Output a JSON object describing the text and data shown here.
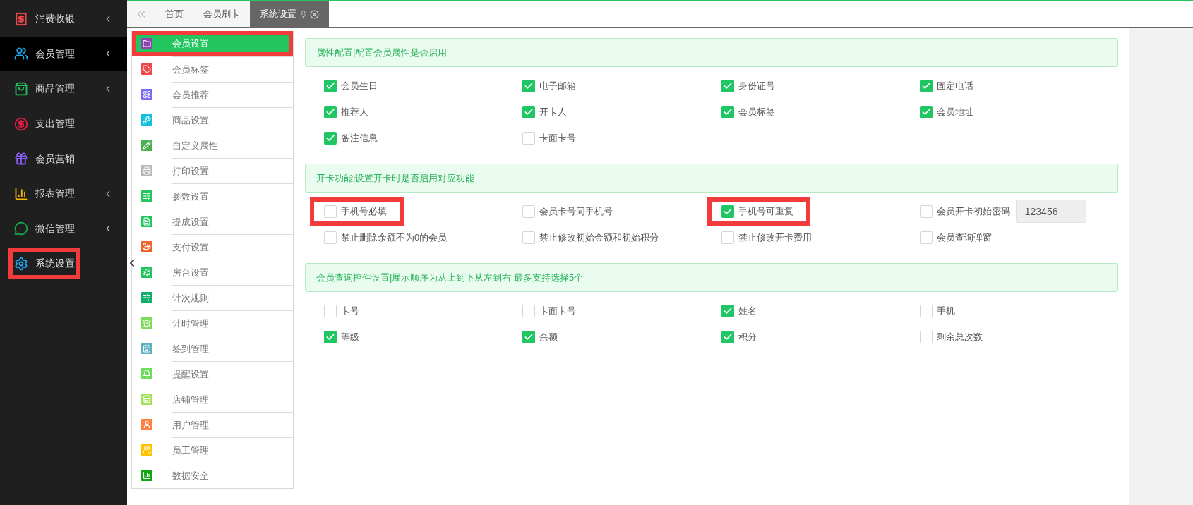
{
  "sidebar": {
    "items": [
      {
        "label": "消费收银",
        "color": "#e5484d",
        "has_submenu": true,
        "selected": false,
        "highlighted": false
      },
      {
        "label": "会员管理",
        "color": "#1ea7f0",
        "has_submenu": true,
        "selected": true,
        "highlighted": false
      },
      {
        "label": "商品管理",
        "color": "#22c55e",
        "has_submenu": true,
        "selected": false,
        "highlighted": false
      },
      {
        "label": "支出管理",
        "color": "#e11d48",
        "has_submenu": false,
        "selected": false,
        "highlighted": false
      },
      {
        "label": "会员营销",
        "color": "#8b5cf6",
        "has_submenu": false,
        "selected": false,
        "highlighted": false
      },
      {
        "label": "报表管理",
        "color": "#f5b50a",
        "has_submenu": true,
        "selected": false,
        "highlighted": false
      },
      {
        "label": "微信管理",
        "color": "#16a34a",
        "has_submenu": true,
        "selected": false,
        "highlighted": false
      },
      {
        "label": "系统设置",
        "color": "#1ea7f0",
        "has_submenu": false,
        "selected": false,
        "highlighted": true
      }
    ]
  },
  "tabs": [
    {
      "label": "首页",
      "selected": false,
      "pinned": false
    },
    {
      "label": "会员刷卡",
      "selected": false,
      "pinned": false
    },
    {
      "label": "系统设置",
      "selected": true,
      "pinned": true
    }
  ],
  "settings_menu": [
    {
      "label": "会员设置",
      "color": "#8e44ad",
      "selected": true,
      "highlighted": true
    },
    {
      "label": "会员标签",
      "color": "#f04848",
      "selected": false,
      "highlighted": false
    },
    {
      "label": "会员推荐",
      "color": "#7b6cf6",
      "selected": false,
      "highlighted": false
    },
    {
      "label": "商品设置",
      "color": "#14c0e0",
      "selected": false,
      "highlighted": false
    },
    {
      "label": "自定义属性",
      "color": "#4caf50",
      "selected": false,
      "highlighted": false
    },
    {
      "label": "打印设置",
      "color": "#b8b8b8",
      "selected": false,
      "highlighted": false
    },
    {
      "label": "参数设置",
      "color": "#22c55e",
      "selected": false,
      "highlighted": false
    },
    {
      "label": "提成设置",
      "color": "#22c55e",
      "selected": false,
      "highlighted": false
    },
    {
      "label": "支付设置",
      "color": "#f4622b",
      "selected": false,
      "highlighted": false
    },
    {
      "label": "房台设置",
      "color": "#22c55e",
      "selected": false,
      "highlighted": false
    },
    {
      "label": "计次规则",
      "color": "#0fae6a",
      "selected": false,
      "highlighted": false
    },
    {
      "label": "计时管理",
      "color": "#7ed957",
      "selected": false,
      "highlighted": false
    },
    {
      "label": "签到管理",
      "color": "#5bb0c0",
      "selected": false,
      "highlighted": false
    },
    {
      "label": "提醒设置",
      "color": "#6ddc5a",
      "selected": false,
      "highlighted": false
    },
    {
      "label": "店铺管理",
      "color": "#a3e05a",
      "selected": false,
      "highlighted": false
    },
    {
      "label": "用户管理",
      "color": "#ff8040",
      "selected": false,
      "highlighted": false
    },
    {
      "label": "员工管理",
      "color": "#ffc400",
      "selected": false,
      "highlighted": false
    },
    {
      "label": "数据安全",
      "color": "#11a611",
      "selected": false,
      "highlighted": false
    }
  ],
  "sections": [
    {
      "title": "属性配置|配置会员属性是否启用",
      "options": [
        {
          "label": "会员生日",
          "checked": true,
          "highlighted": false
        },
        {
          "label": "电子邮箱",
          "checked": true,
          "highlighted": false
        },
        {
          "label": "身份证号",
          "checked": true,
          "highlighted": false
        },
        {
          "label": "固定电话",
          "checked": true,
          "highlighted": false
        },
        {
          "label": "推荐人",
          "checked": true,
          "highlighted": false
        },
        {
          "label": "开卡人",
          "checked": true,
          "highlighted": false
        },
        {
          "label": "会员标签",
          "checked": true,
          "highlighted": false
        },
        {
          "label": "会员地址",
          "checked": true,
          "highlighted": false
        },
        {
          "label": "备注信息",
          "checked": true,
          "highlighted": false
        },
        {
          "label": "卡面卡号",
          "checked": false,
          "highlighted": false
        }
      ]
    },
    {
      "title": "开卡功能|设置开卡时是否启用对应功能",
      "options": [
        {
          "label": "手机号必填",
          "checked": false,
          "highlighted": true
        },
        {
          "label": "会员卡号同手机号",
          "checked": false,
          "highlighted": false
        },
        {
          "label": "手机号可重复",
          "checked": true,
          "highlighted": true
        },
        {
          "label": "会员开卡初始密码",
          "checked": false,
          "highlighted": false,
          "value": "123456"
        },
        {
          "label": "禁止删除余额不为0的会员",
          "checked": false,
          "highlighted": false
        },
        {
          "label": "禁止修改初始金额和初始积分",
          "checked": false,
          "highlighted": false
        },
        {
          "label": "禁止修改开卡费用",
          "checked": false,
          "highlighted": false
        },
        {
          "label": "会员查询弹窗",
          "checked": false,
          "highlighted": false
        }
      ]
    },
    {
      "title": "会员查询控件设置|展示顺序为从上到下从左到右 最多支持选择5个",
      "options": [
        {
          "label": "卡号",
          "checked": false,
          "highlighted": false
        },
        {
          "label": "卡面卡号",
          "checked": false,
          "highlighted": false
        },
        {
          "label": "姓名",
          "checked": true,
          "highlighted": false
        },
        {
          "label": "手机",
          "checked": false,
          "highlighted": false
        },
        {
          "label": "等级",
          "checked": true,
          "highlighted": false
        },
        {
          "label": "余额",
          "checked": true,
          "highlighted": false
        },
        {
          "label": "积分",
          "checked": true,
          "highlighted": false
        },
        {
          "label": "剩余总次数",
          "checked": false,
          "highlighted": false
        }
      ]
    }
  ]
}
